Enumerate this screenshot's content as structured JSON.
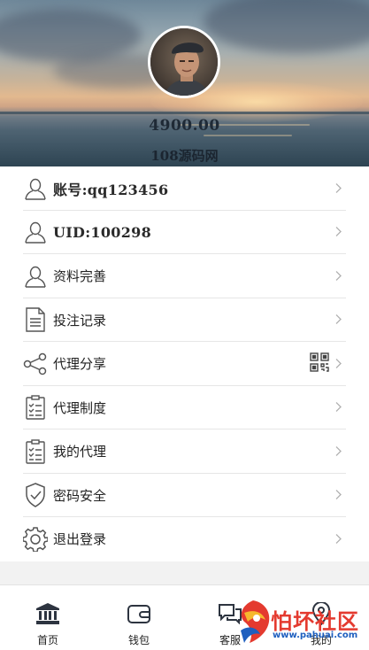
{
  "header": {
    "balance": "4900.00",
    "site_name": "108源码网"
  },
  "menu": [
    {
      "label": "账号:qq123456",
      "icon": "user-icon"
    },
    {
      "label": "UID:100298",
      "icon": "user-icon"
    },
    {
      "label": "资料完善",
      "icon": "user-icon"
    },
    {
      "label": "投注记录",
      "icon": "document-icon"
    },
    {
      "label": "代理分享",
      "icon": "share-icon",
      "extra_icon": "qr-code-icon"
    },
    {
      "label": "代理制度",
      "icon": "clipboard-list-icon"
    },
    {
      "label": "我的代理",
      "icon": "clipboard-list-icon"
    },
    {
      "label": "密码安全",
      "icon": "shield-check-icon"
    },
    {
      "label": "退出登录",
      "icon": "gear-icon"
    }
  ],
  "bottom_nav": [
    {
      "label": "首页",
      "icon": "bank-icon"
    },
    {
      "label": "钱包",
      "icon": "wallet-icon"
    },
    {
      "label": "客服",
      "icon": "chat-icon"
    },
    {
      "label": "我的",
      "icon": "location-icon"
    }
  ],
  "watermark": {
    "text": "怕坏社区",
    "url": "www.pahuai.com"
  },
  "colors": {
    "text": "#222222",
    "divider": "#e6e6e6",
    "chevron": "#b0b0b0",
    "watermark_red": "#e43a2f",
    "watermark_blue": "#1e5fbf"
  }
}
